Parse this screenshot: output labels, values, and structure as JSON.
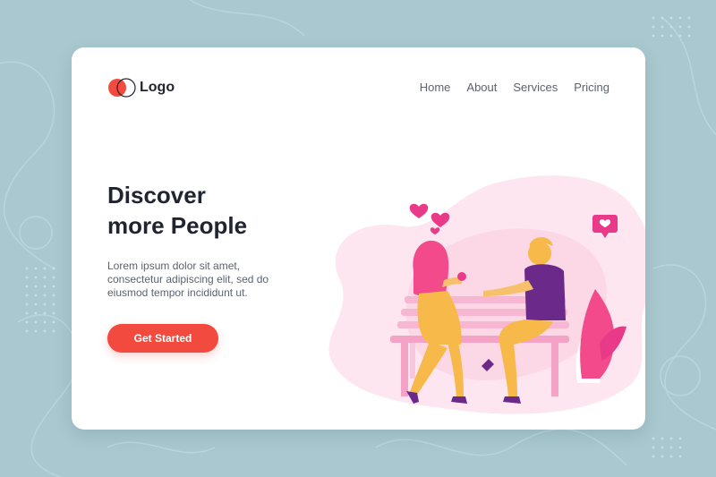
{
  "brand": {
    "logo_text": "Logo",
    "accent_color": "#f24a3e"
  },
  "nav": {
    "items": [
      "Home",
      "About",
      "Services",
      "Pricing"
    ]
  },
  "hero": {
    "title_line1": "Discover",
    "title_line2": "more People",
    "description": "Lorem ipsum dolor sit amet, consectetur adipiscing elit, sed do eiusmod tempor incididunt ut.",
    "cta_label": "Get Started"
  },
  "colors": {
    "background": "#a9c8cf",
    "card": "#ffffff",
    "heading": "#1f2430",
    "body_text": "#5c6270",
    "pink": "#f7a8c8",
    "hot_pink": "#e93a8a",
    "orange": "#f7b94a",
    "purple": "#6b2a8a"
  },
  "illustration": {
    "subject": "couple-on-bench",
    "icons": [
      "heart-icon",
      "chat-heart-icon",
      "plant-icon"
    ]
  }
}
